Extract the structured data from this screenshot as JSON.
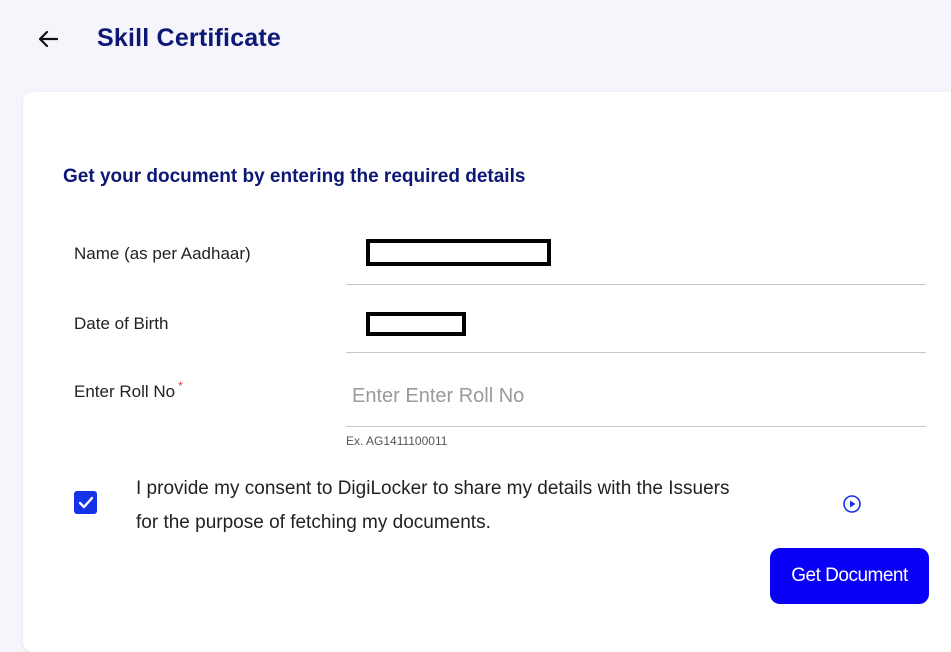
{
  "header": {
    "back_icon": "arrow-left-icon",
    "title": "Skill Certificate"
  },
  "form": {
    "subtitle": "Get your document by entering the required details",
    "name_label": "Name (as per Aadhaar)",
    "dob_label": "Date of Birth",
    "roll_label": "Enter Roll No",
    "required_mark": "*",
    "roll_placeholder": "Enter Enter Roll No",
    "roll_value": "",
    "roll_hint": "Ex. AG1411100011",
    "consent_checked": true,
    "consent_text": "I provide my consent to DigiLocker to share my details with the Issuers for the purpose of fetching my documents.",
    "play_icon": "play-circle-icon",
    "submit_label": "Get Document"
  },
  "colors": {
    "title": "#0d1775",
    "primary_button": "#0a00f5",
    "checkbox": "#1432e6",
    "required": "#e53935"
  }
}
